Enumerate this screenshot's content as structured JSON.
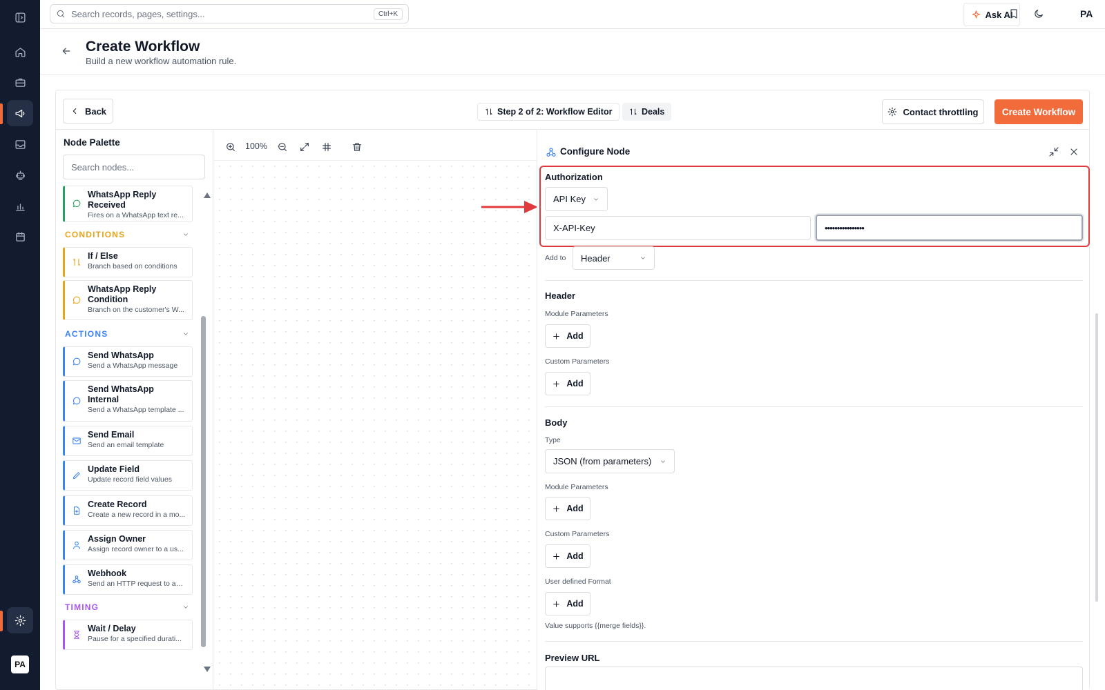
{
  "topbar": {
    "search_placeholder": "Search records, pages, settings...",
    "search_shortcut": "Ctrl+K",
    "ask_ai": "Ask AI",
    "avatar": "PA"
  },
  "rail": {
    "avatar": "PA",
    "accent": "#f26b3a"
  },
  "page": {
    "title": "Create Workflow",
    "subtitle": "Build a new workflow automation rule."
  },
  "toolbar": {
    "back": "Back",
    "step": "Step 2 of 2: Workflow Editor",
    "module": "Deals",
    "throttling": "Contact throttling",
    "create": "Create Workflow"
  },
  "palette": {
    "title": "Node Palette",
    "search_placeholder": "Search nodes...",
    "sections": {
      "conditions": "CONDITIONS",
      "actions": "ACTIONS",
      "timing": "TIMING"
    },
    "nodes": {
      "whatsapp_reply_received": {
        "title": "WhatsApp Reply Received",
        "desc": "Fires on a WhatsApp text re..."
      },
      "if_else": {
        "title": "If / Else",
        "desc": "Branch based on conditions"
      },
      "whatsapp_reply_condition": {
        "title": "WhatsApp Reply Condition",
        "desc": "Branch on the customer's W..."
      },
      "send_whatsapp": {
        "title": "Send WhatsApp",
        "desc": "Send a WhatsApp message"
      },
      "send_whatsapp_internal": {
        "title": "Send WhatsApp Internal",
        "desc": "Send a WhatsApp template ..."
      },
      "send_email": {
        "title": "Send Email",
        "desc": "Send an email template"
      },
      "update_field": {
        "title": "Update Field",
        "desc": "Update record field values"
      },
      "create_record": {
        "title": "Create Record",
        "desc": "Create a new record in a mo..."
      },
      "assign_owner": {
        "title": "Assign Owner",
        "desc": "Assign record owner to a us..."
      },
      "webhook": {
        "title": "Webhook",
        "desc": "Send an HTTP request to an ..."
      },
      "wait_delay": {
        "title": "Wait / Delay",
        "desc": "Pause for a specified durati..."
      }
    },
    "colors": {
      "trigger": "#22a35a",
      "condition": "#e8a317",
      "action": "#3b82f6",
      "timing": "#a855f7"
    }
  },
  "canvas": {
    "zoom": "100%"
  },
  "config": {
    "title": "Configure Node",
    "authorization": {
      "label": "Authorization",
      "type": "API Key",
      "key_name": "X-API-Key",
      "key_value": "••••••••••••••••",
      "add_to_label": "Add to",
      "add_to_value": "Header"
    },
    "header": {
      "title": "Header",
      "module_params": "Module Parameters",
      "custom_params": "Custom Parameters",
      "add": "Add"
    },
    "body": {
      "title": "Body",
      "type_label": "Type",
      "type_value": "JSON (from parameters)",
      "module_params": "Module Parameters",
      "custom_params": "Custom Parameters",
      "user_format": "User defined Format",
      "hint": "Value supports {{merge fields}}.",
      "add": "Add"
    },
    "preview_url": "Preview URL",
    "highlight_color": "#e0393e"
  }
}
